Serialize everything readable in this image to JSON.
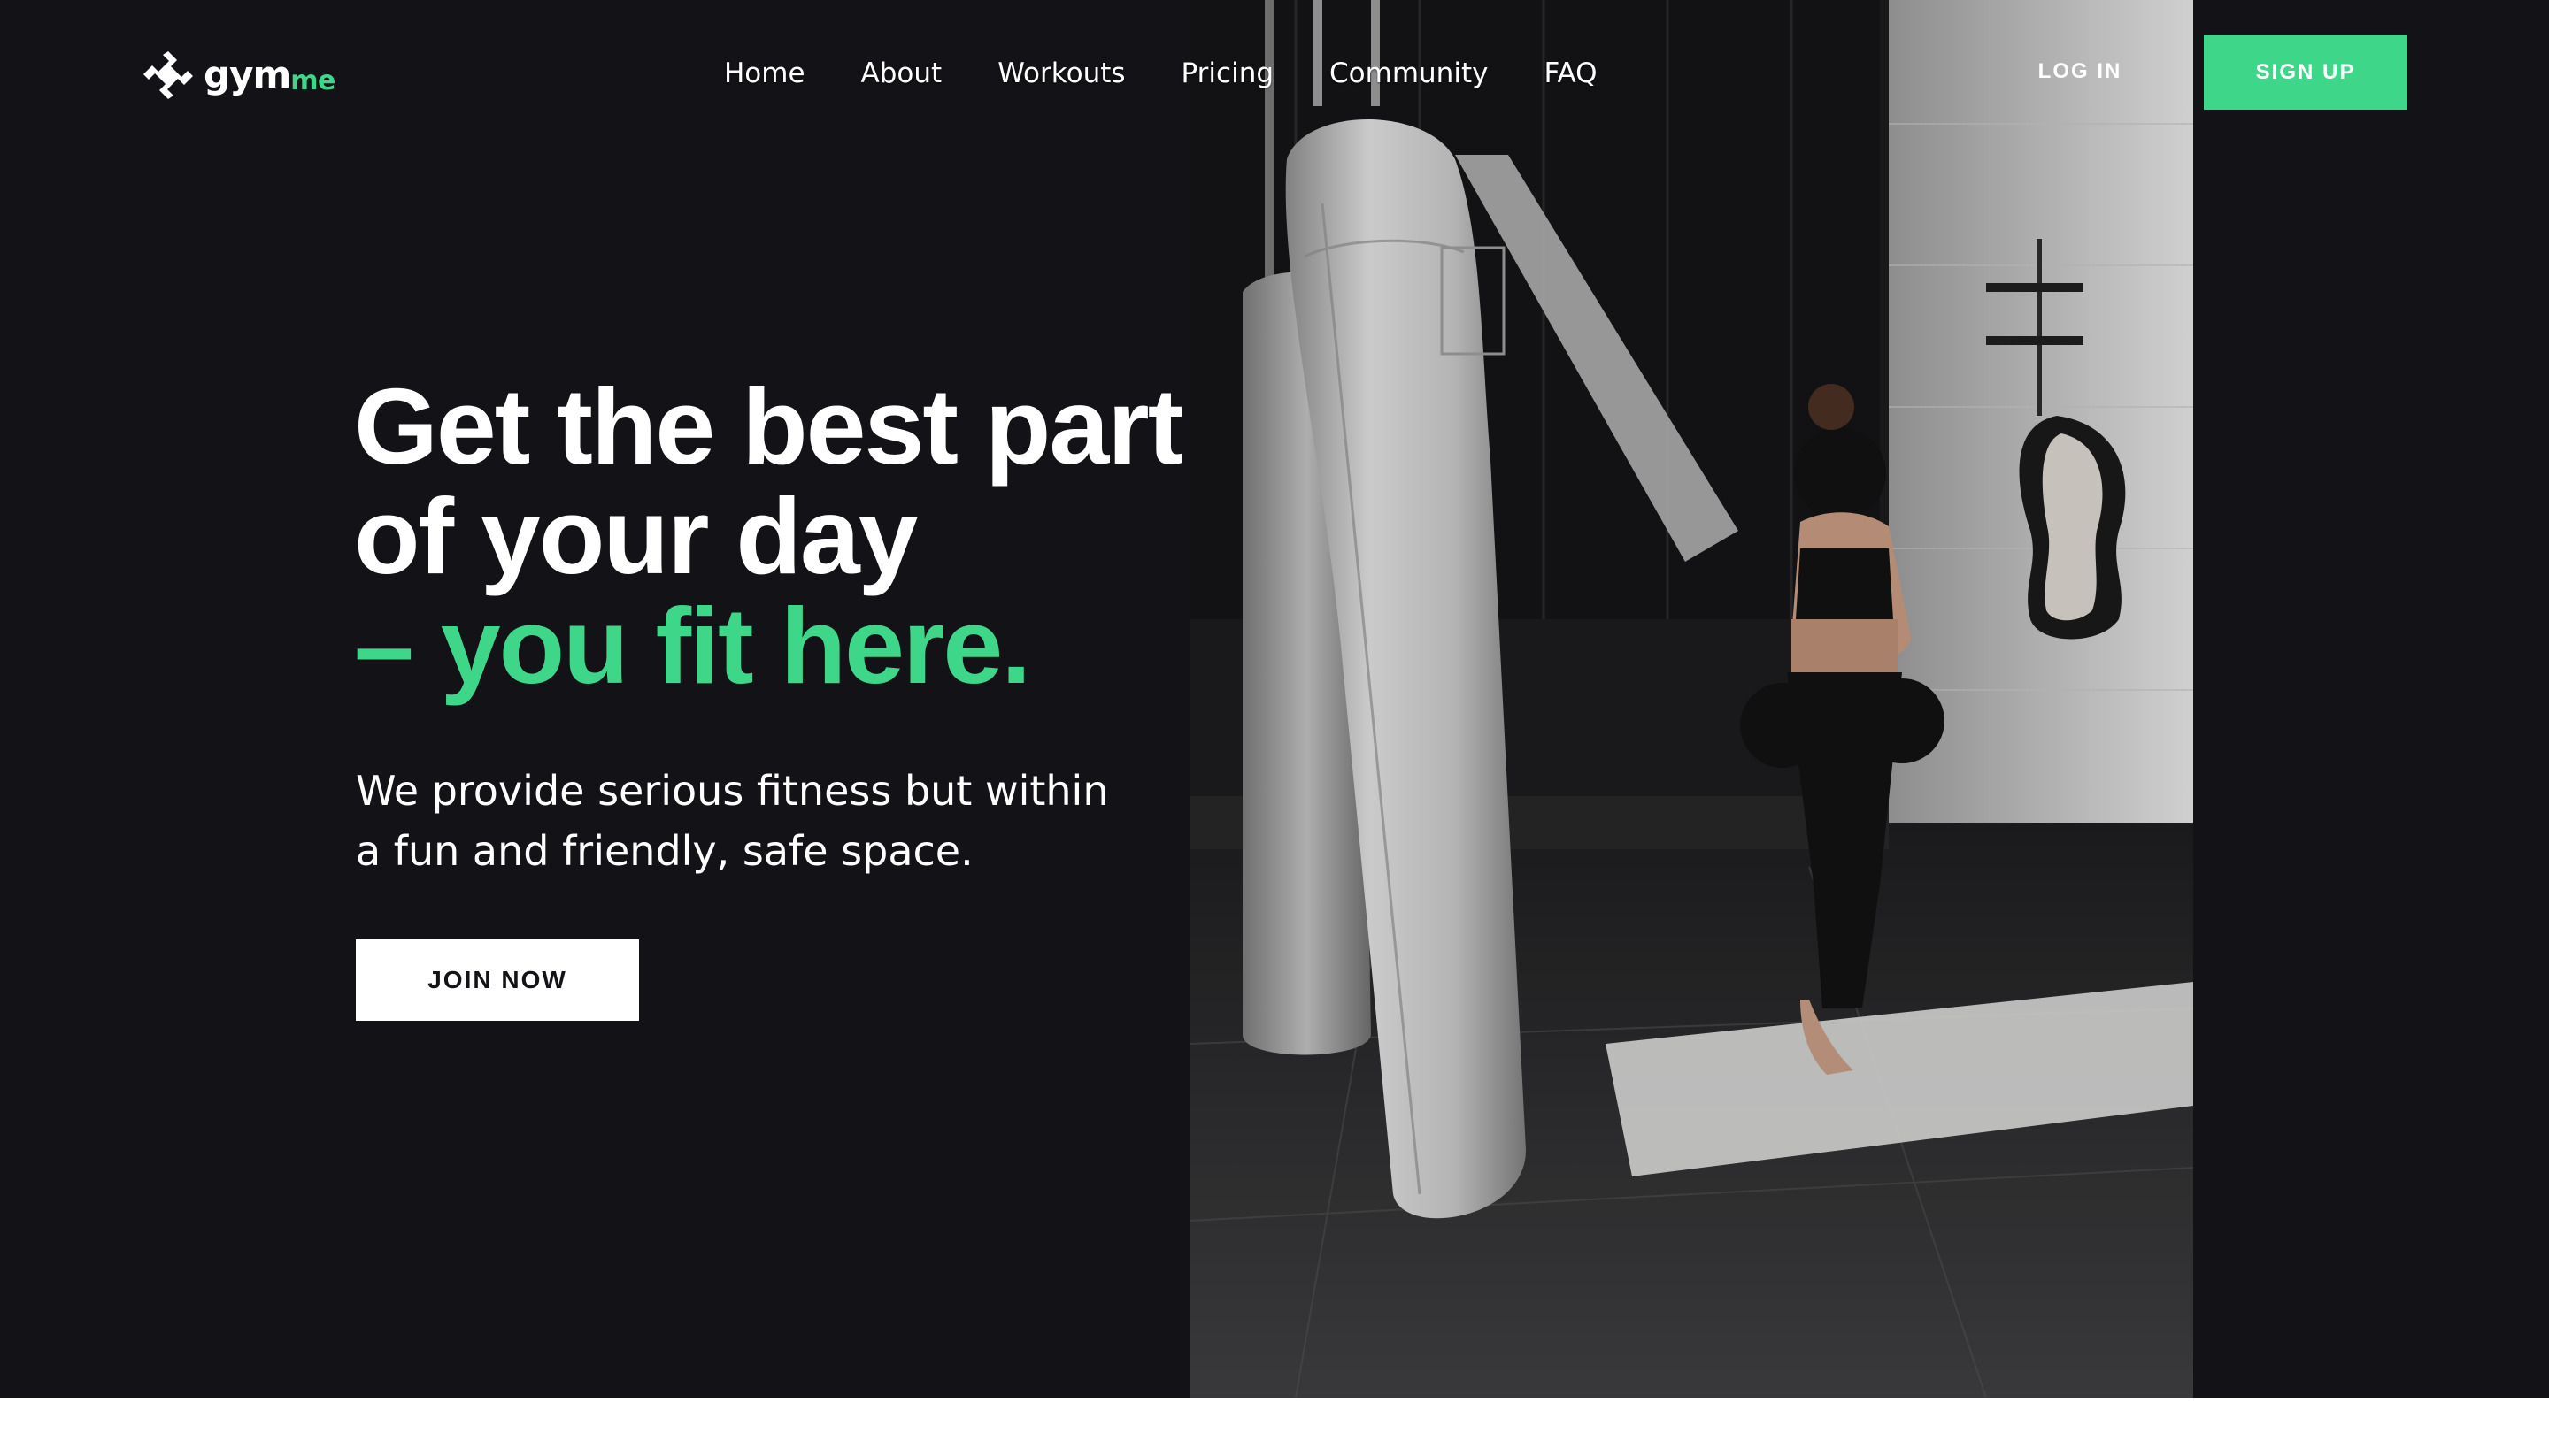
{
  "brand": {
    "name": "gym",
    "accent": "me",
    "accent_color": "#3ed789",
    "icon": "gymme-logo-icon"
  },
  "nav": {
    "items": [
      "Home",
      "About",
      "Workouts",
      "Pricing",
      "Community",
      "FAQ"
    ]
  },
  "auth": {
    "login_label": "LOG IN",
    "signup_label": "SIGN UP"
  },
  "hero": {
    "headline_lines": [
      "Get the best part",
      "of your day"
    ],
    "headline_accent": "– you fit here.",
    "subtitle_lines": [
      "We provide serious fitness but within",
      "a fun and friendly, safe space."
    ],
    "cta_label": "JOIN NOW",
    "image": "boxing-gym-photo"
  },
  "colors": {
    "background": "#131216",
    "accent": "#3ed789",
    "text": "#ffffff"
  }
}
